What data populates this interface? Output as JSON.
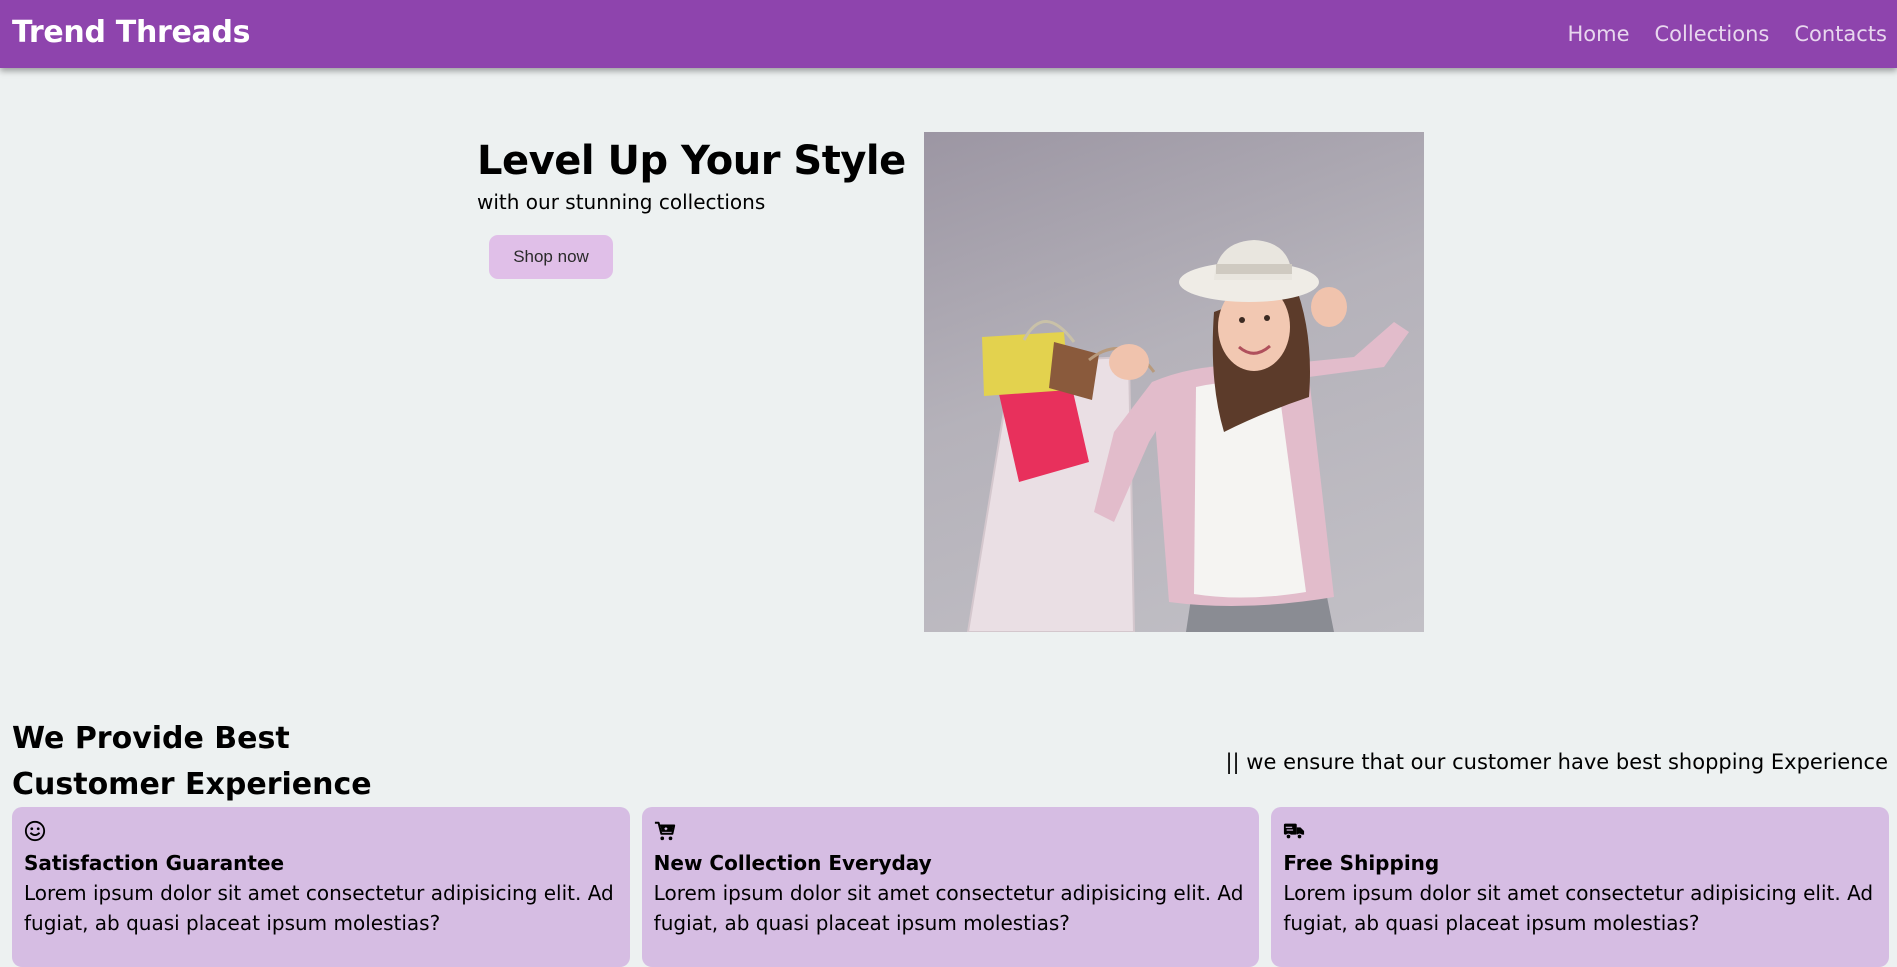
{
  "navbar": {
    "brand": "Trend Threads",
    "links": [
      "Home",
      "Collections",
      "Contacts"
    ],
    "background_color": "#8e44ad"
  },
  "hero": {
    "title": "Level Up Your Style",
    "subtitle": "with our stunning collections",
    "button_label": "Shop now",
    "button_color": "#e0bfe8"
  },
  "features_section": {
    "title": "We Provide Best Customer Experience",
    "tagline": "|| we ensure that our customer have best shopping Experience",
    "card_color": "#d6bde3",
    "cards": [
      {
        "icon": "smile-icon",
        "title": "Satisfaction Guarantee",
        "text": "Lorem ipsum dolor sit amet consectetur adipisicing elit. Ad fugiat, ab quasi placeat ipsum molestias?"
      },
      {
        "icon": "cart-icon",
        "title": "New Collection Everyday",
        "text": "Lorem ipsum dolor sit amet consectetur adipisicing elit. Ad fugiat, ab quasi placeat ipsum molestias?"
      },
      {
        "icon": "truck-icon",
        "title": "Free Shipping",
        "text": "Lorem ipsum dolor sit amet consectetur adipisicing elit. Ad fugiat, ab quasi placeat ipsum molestias?"
      }
    ]
  }
}
